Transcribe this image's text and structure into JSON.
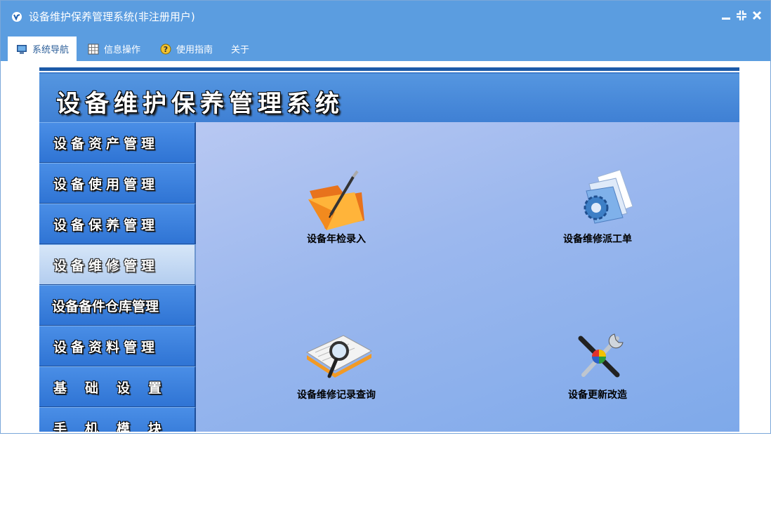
{
  "window": {
    "title": "设备维护保养管理系统(非注册用户)"
  },
  "tabs": [
    {
      "label": "系统导航",
      "icon": "monitor-icon",
      "active": true
    },
    {
      "label": "信息操作",
      "icon": "grid-icon",
      "active": false
    },
    {
      "label": "使用指南",
      "icon": "help-icon",
      "active": false
    },
    {
      "label": "关于",
      "icon": "",
      "active": false
    }
  ],
  "banner": {
    "title": "设备维护保养管理系统"
  },
  "sidebar": {
    "items": [
      {
        "label": "设备资产管理",
        "active": false
      },
      {
        "label": "设备使用管理",
        "active": false
      },
      {
        "label": "设备保养管理",
        "active": false
      },
      {
        "label": "设备维修管理",
        "active": true
      },
      {
        "label": "设备备件仓库管理",
        "active": false
      },
      {
        "label": "设备资料管理",
        "active": false
      },
      {
        "label": "基础设置",
        "active": false
      },
      {
        "label": "手机模块",
        "active": false
      }
    ]
  },
  "functions": [
    {
      "label": "设备年检录入",
      "icon": "folder-pen-icon"
    },
    {
      "label": "设备维修派工单",
      "icon": "gear-document-icon"
    },
    {
      "label": "设备维修记录查询",
      "icon": "magnifier-document-icon"
    },
    {
      "label": "设备更新改造",
      "icon": "tools-icon"
    }
  ],
  "colors": {
    "titlebar": "#5b9de0",
    "banner": "#4a8be0",
    "sidebar": "#2f74d4",
    "main_bg": "#9cb8ee"
  }
}
